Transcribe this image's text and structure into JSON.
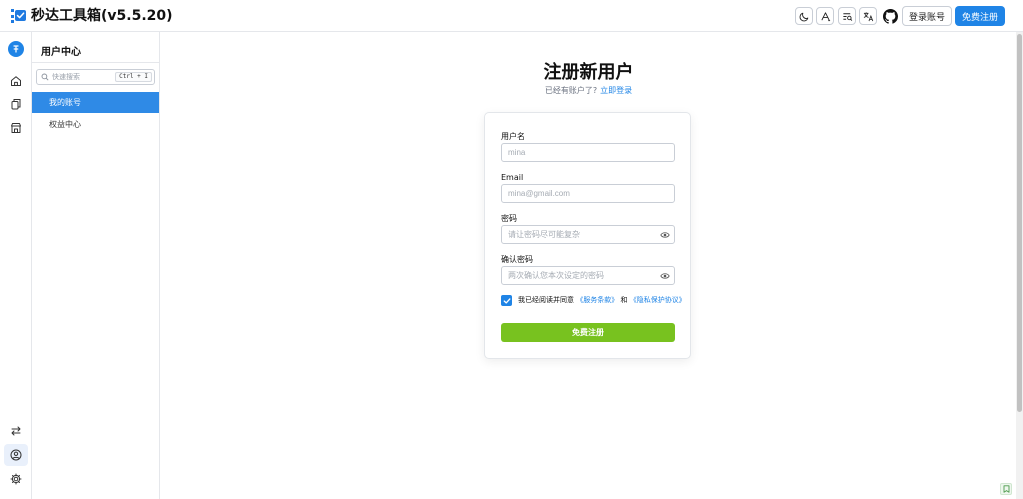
{
  "app": {
    "title": "秒达工具箱(v5.5.20)",
    "accent_color": "#1f84e6",
    "submit_color": "#78c21f"
  },
  "header": {
    "icons": [
      "moon-icon",
      "text-format-icon",
      "search-list-icon",
      "translate-icon",
      "github-icon"
    ],
    "login_label": "登录账号",
    "signup_label": "免费注册"
  },
  "sidebar": {
    "title": "用户中心",
    "search_placeholder": "快速搜索",
    "search_shortcut": "Ctrl + I",
    "items": [
      {
        "label": "我的账号",
        "active": true
      },
      {
        "label": "权益中心",
        "active": false
      }
    ]
  },
  "form": {
    "title": "注册新用户",
    "subtitle": "已经有账户了?",
    "login_link": "立即登录",
    "username_label": "用户名",
    "username_placeholder": "mina",
    "email_label": "Email",
    "email_placeholder": "mina@gmail.com",
    "password_label": "密码",
    "password_placeholder": "请让密码尽可能复杂",
    "confirm_label": "确认密码",
    "confirm_placeholder": "两次确认您本次设定的密码",
    "agree_checked": true,
    "agree_prefix": "我已经阅读并同意",
    "terms_link": "《服务条款》",
    "agree_and": "和",
    "privacy_link": "《隐私保护协议》",
    "submit_label": "免费注册"
  }
}
